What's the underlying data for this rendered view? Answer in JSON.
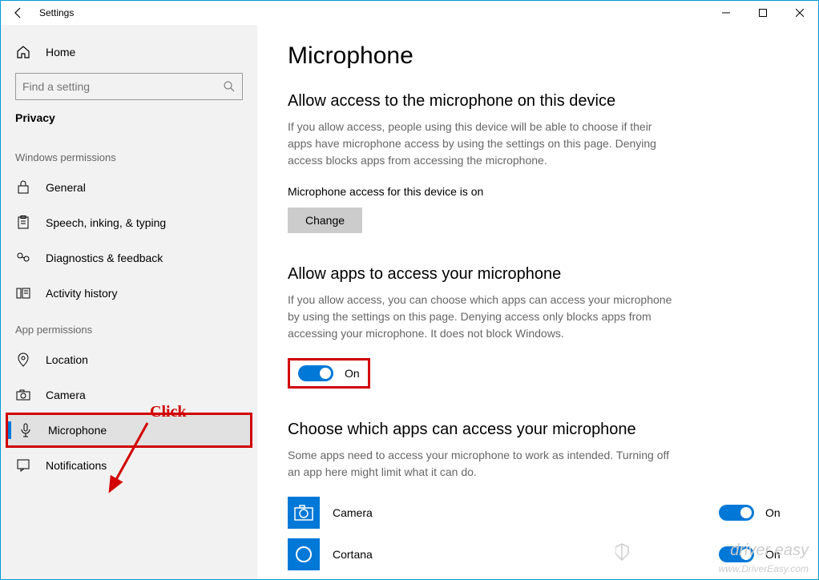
{
  "titlebar": {
    "title": "Settings"
  },
  "sidebar": {
    "home": "Home",
    "search_placeholder": "Find a setting",
    "header": "Privacy",
    "group1": "Windows permissions",
    "items1": [
      "General",
      "Speech, inking, & typing",
      "Diagnostics & feedback",
      "Activity history"
    ],
    "group2": "App permissions",
    "items2": [
      "Location",
      "Camera",
      "Microphone",
      "Notifications"
    ]
  },
  "main": {
    "title": "Microphone",
    "s1": {
      "heading": "Allow access to the microphone on this device",
      "desc": "If you allow access, people using this device will be able to choose if their apps have microphone access by using the settings on this page. Denying access blocks apps from accessing the microphone.",
      "status": "Microphone access for this device is on",
      "button": "Change"
    },
    "s2": {
      "heading": "Allow apps to access your microphone",
      "desc": "If you allow access, you can choose which apps can access your microphone by using the settings on this page. Denying access only blocks apps from accessing your microphone. It does not block Windows.",
      "toggle_label": "On"
    },
    "s3": {
      "heading": "Choose which apps can access your microphone",
      "desc": "Some apps need to access your microphone to work as intended. Turning off an app here might limit what it can do.",
      "apps": [
        {
          "name": "Camera",
          "state": "On"
        },
        {
          "name": "Cortana",
          "state": "On"
        }
      ]
    }
  },
  "annotation": {
    "click": "Click"
  },
  "watermark": {
    "brand": "driver easy",
    "url": "www.DriverEasy.com"
  }
}
